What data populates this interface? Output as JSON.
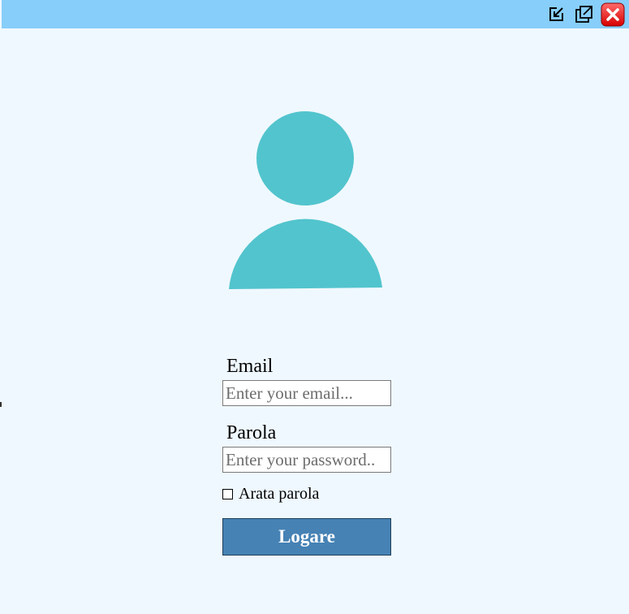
{
  "window": {
    "titlebar_color": "#87cefa",
    "controls": [
      "minimize-icon",
      "popout-icon",
      "close-icon"
    ]
  },
  "avatar": {
    "icon": "user-avatar-icon",
    "color": "#52c4cd"
  },
  "form": {
    "email_label": "Email",
    "email_placeholder": "Enter your email...",
    "email_value": "",
    "password_label": "Parola",
    "password_placeholder": "Enter your password..",
    "password_value": "",
    "show_password_label": "Arata parola",
    "show_password_checked": false,
    "login_label": "Logare",
    "login_color": "#4682b4"
  }
}
